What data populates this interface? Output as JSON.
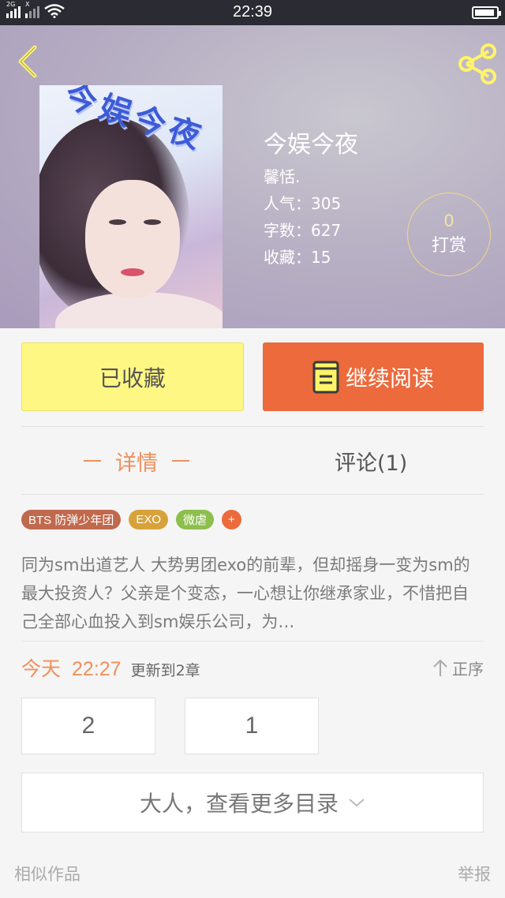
{
  "status_bar": {
    "time": "22:39",
    "network1": "2G",
    "network2": "X"
  },
  "book": {
    "title": "今娱今夜",
    "author": "馨恬.",
    "popularity": "人气：305",
    "word_count": "字数：627",
    "favorites": "收藏：15",
    "cover_art_text": "今娱今夜"
  },
  "reward": {
    "count": "0",
    "label": "打赏"
  },
  "actions": {
    "favorited_label": "已收藏",
    "continue_label": "继续阅读"
  },
  "tabs": {
    "detail": "详情",
    "comments": "评论(1)"
  },
  "tags": [
    {
      "label": "BTS  防弹少年团",
      "color": "#c0694d"
    },
    {
      "label": "EXO",
      "color": "#d8a23a"
    },
    {
      "label": "微虐",
      "color": "#8cbf4c"
    },
    {
      "label": "+",
      "color": "#ec6a3c"
    }
  ],
  "description": "同为sm出道艺人 大势男团exo的前辈，但却摇身一变为sm的最大投资人？父亲是个变态，一心想让你继承家业，不惜把自己全部心血投入到sm娱乐公司，为…",
  "update": {
    "day": "今天",
    "time": "22:27",
    "note": "更新到2章",
    "sort_label": "正序"
  },
  "chapters": [
    "2",
    "1"
  ],
  "more_label": "大人，查看更多目录",
  "footer": {
    "similar": "相似作品",
    "report": "举报"
  },
  "colors": {
    "accent": "#ec6a3c",
    "favorite_bg": "#fff783",
    "tab_active": "#f08f5c"
  }
}
